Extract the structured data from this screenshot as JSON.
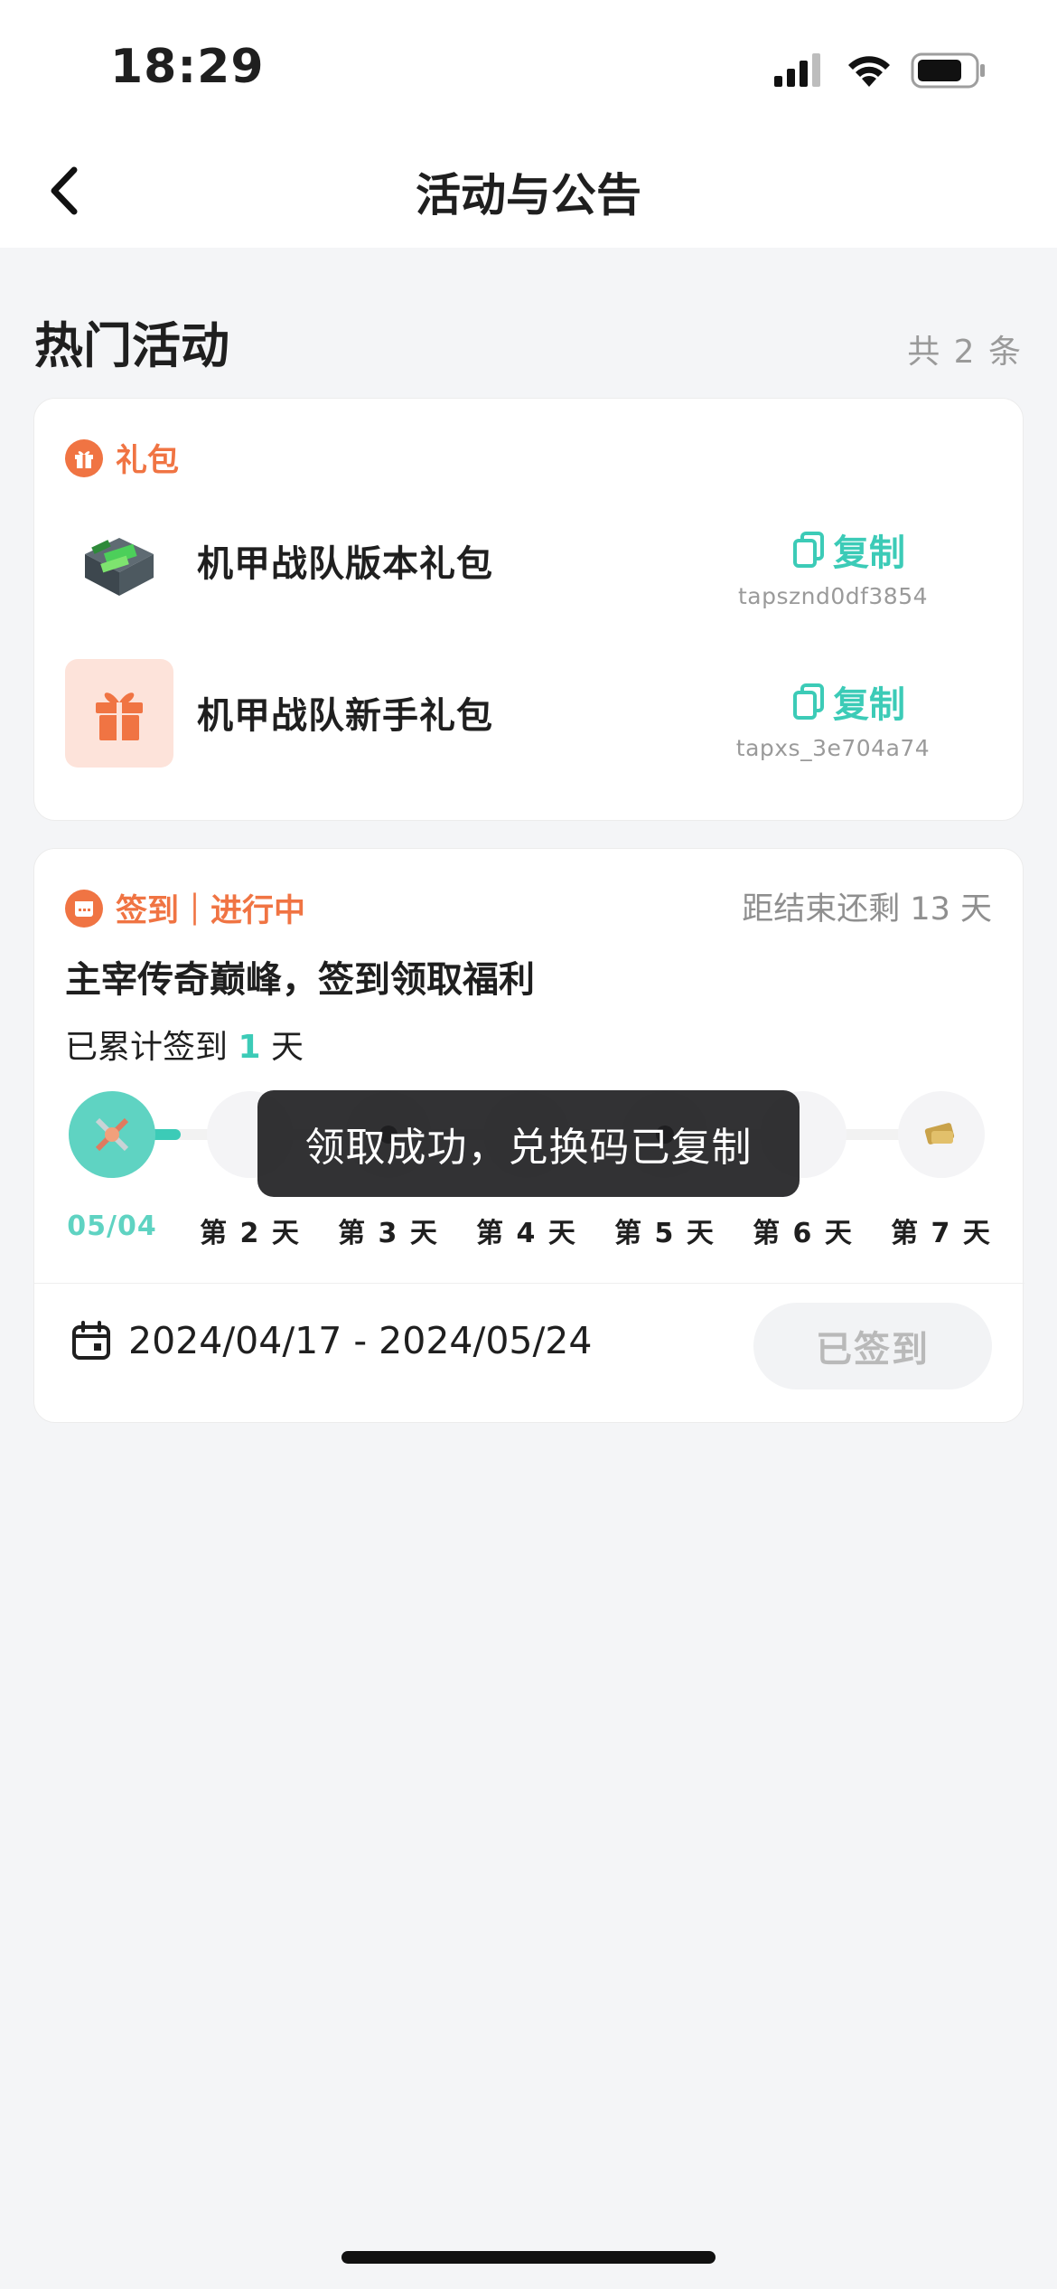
{
  "status_bar": {
    "time": "18:29"
  },
  "nav": {
    "title": "活动与公告"
  },
  "section": {
    "title": "热门活动",
    "count": "共 2 条"
  },
  "gift_card": {
    "tag": "礼包",
    "items": [
      {
        "name": "机甲战队版本礼包",
        "copy_label": "复制",
        "code": "tapsznd0df3854",
        "thumb": "mech-crate-icon"
      },
      {
        "name": "机甲战队新手礼包",
        "copy_label": "复制",
        "code": "tapxs_3e704a74",
        "thumb": "gift-box-icon"
      }
    ]
  },
  "signin_card": {
    "tag": "签到｜进行中",
    "remaining": "距结束还剩 13 天",
    "title": "主宰传奇巅峰，签到领取福利",
    "count_prefix": "已累计签到 ",
    "count_value": "1",
    "count_suffix": " 天",
    "days": [
      "05/04",
      "第 2 天",
      "第 3 天",
      "第 4 天",
      "第 5 天",
      "第 6 天",
      "第 7 天"
    ],
    "progress_days": 1,
    "date_range": "2024/04/17 - 2024/05/24",
    "signed_label": "已签到"
  },
  "toast": {
    "message": "领取成功，兑换码已复制"
  },
  "colors": {
    "accent": "#3ccbb7",
    "tag": "#f07443",
    "background": "#f4f5f7"
  }
}
